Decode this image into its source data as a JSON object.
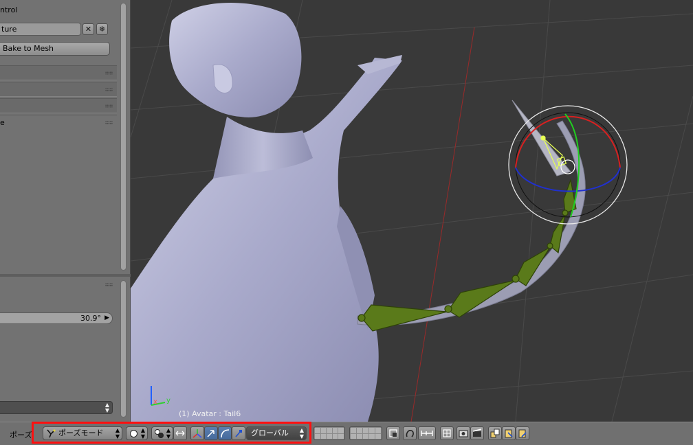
{
  "panel": {
    "control_label": "ntrol",
    "armature_field": "ture",
    "bake_button": "Bake to Mesh",
    "section_label_e": "e",
    "angle_value": "30.9°"
  },
  "viewport": {
    "object_label": "(1) Avatar : Tail6",
    "axis_x": "x",
    "axis_y": "y"
  },
  "bottombar": {
    "editor_label": "ポーズ",
    "mode_label": "ポーズモード",
    "orientation_label": "グローバル"
  },
  "colors": {
    "panel_bg": "#727272",
    "viewport_bg": "#393939",
    "bone_green": "#5a7a1a",
    "highlight_red": "#ff1010"
  }
}
